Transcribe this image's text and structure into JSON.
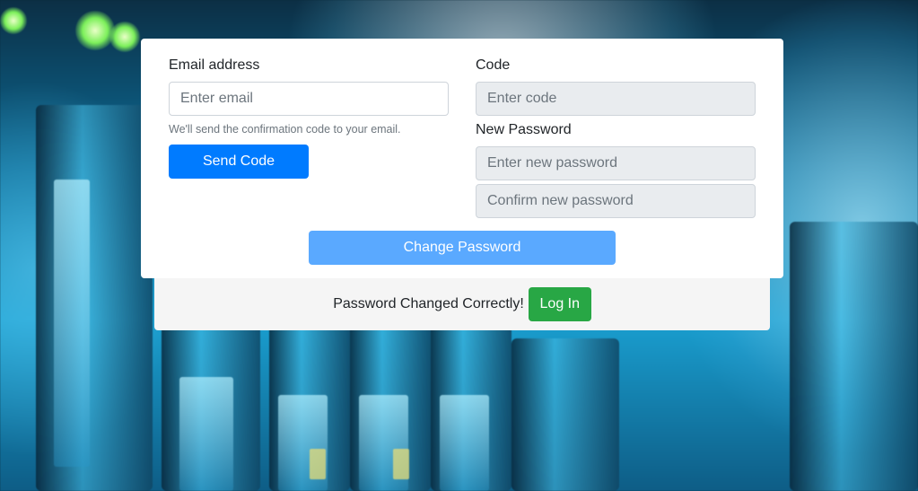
{
  "form": {
    "email_label": "Email address",
    "email_placeholder": "Enter email",
    "email_help": "We'll send the confirmation code to your email.",
    "send_code_label": "Send Code",
    "code_label": "Code",
    "code_placeholder": "Enter code",
    "new_password_label": "New Password",
    "new_password_placeholder": "Enter new password",
    "confirm_password_placeholder": "Confirm new password",
    "change_password_label": "Change Password"
  },
  "footer": {
    "message": "Password Changed Correctly!",
    "login_label": "Log In"
  },
  "colors": {
    "primary": "#007bff",
    "primary_disabled": "#5aa9ff",
    "success": "#28a745",
    "disabled_input": "#e9ecef"
  }
}
